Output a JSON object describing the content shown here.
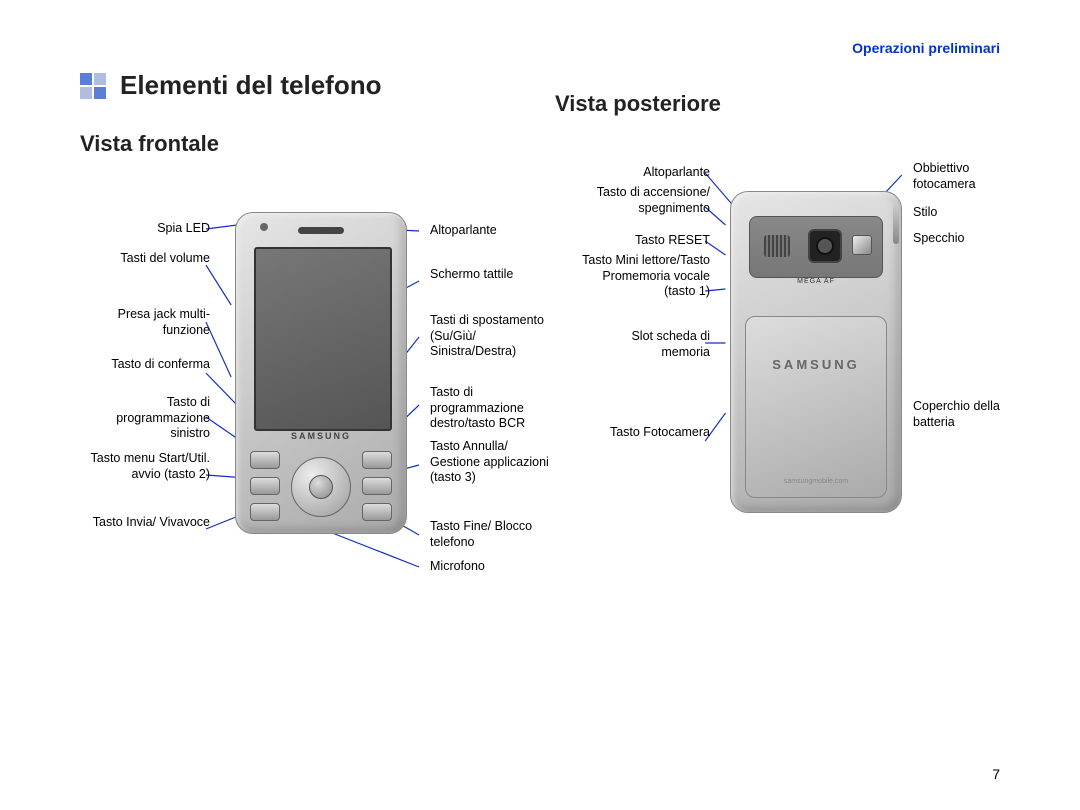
{
  "header": "Operazioni preliminari",
  "main_title": "Elementi del telefono",
  "front_title": "Vista frontale",
  "rear_title": "Vista posteriore",
  "page_number": "7",
  "phone_brand": "SAMSUNG",
  "phone_url": "samsungmobile.com",
  "mega_label": "MEGA AF",
  "front": {
    "left": [
      "Spia LED",
      "Tasti del volume",
      "Presa jack multi-funzione",
      "Tasto di conferma",
      "Tasto di programmazione sinistro",
      "Tasto menu Start/Util. avvio (tasto 2)",
      "Tasto Invia/ Vivavoce"
    ],
    "right": [
      "Altoparlante",
      "Schermo tattile",
      "Tasti di spostamento (Su/Giù/ Sinistra/Destra)",
      "Tasto di programmazione destro/tasto BCR",
      "Tasto Annulla/ Gestione applicazioni (tasto 3)",
      "Tasto Fine/ Blocco telefono",
      "Microfono"
    ]
  },
  "rear": {
    "left": [
      "Altoparlante",
      "Tasto di accensione/ spegnimento",
      "Tasto RESET",
      "Tasto Mini lettore/Tasto Promemoria vocale (tasto 1)",
      "Slot scheda di memoria",
      "Tasto Fotocamera"
    ],
    "right": [
      "Obbiettivo fotocamera",
      "Stilo",
      "Specchio",
      "Coperchio della batteria"
    ]
  }
}
